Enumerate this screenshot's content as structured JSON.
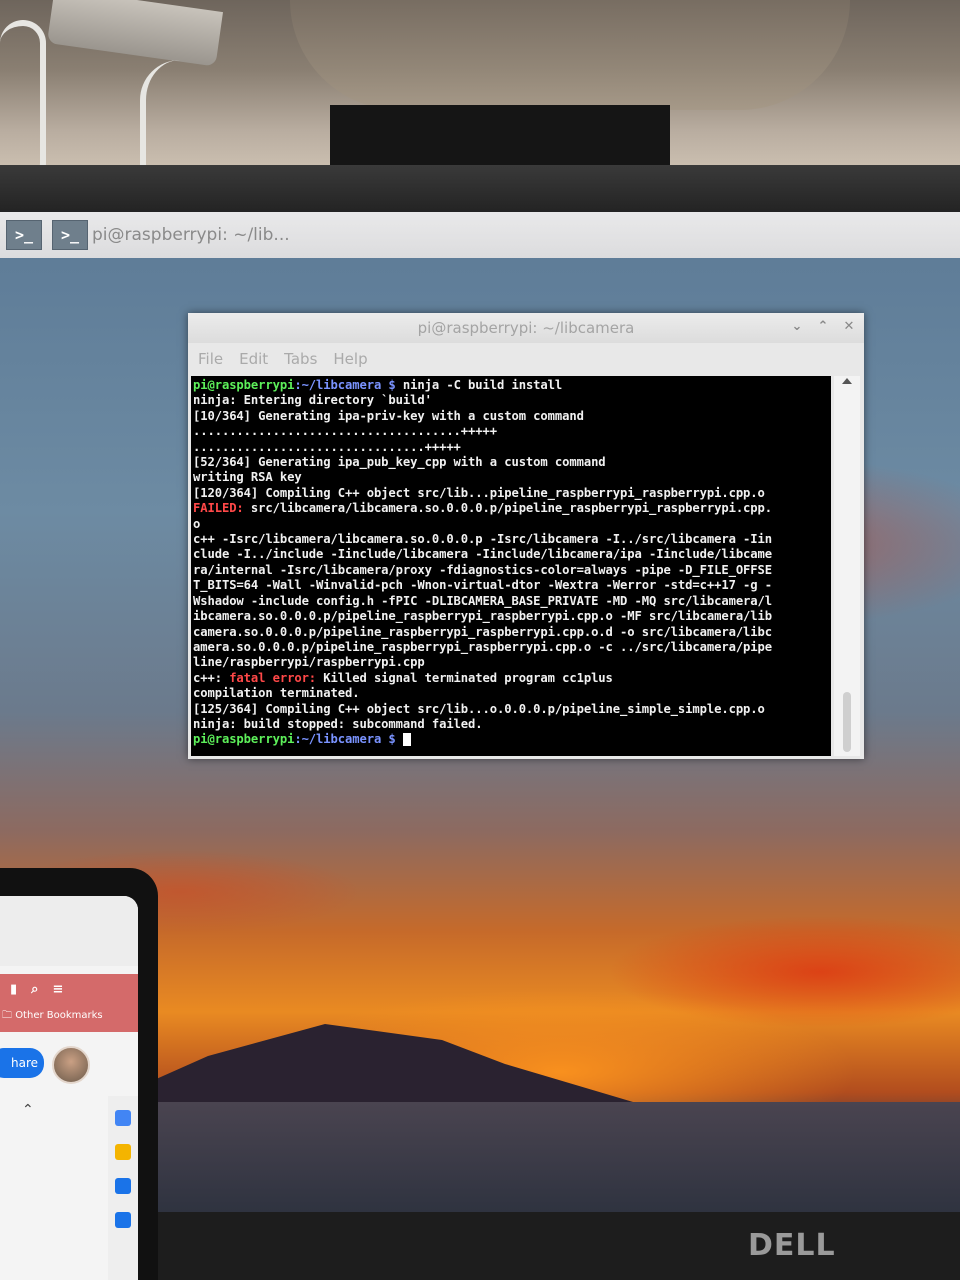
{
  "taskbar": {
    "task_label": "pi@raspberrypi: ~/lib...",
    "terminal_glyph": ">_"
  },
  "window": {
    "title": "pi@raspberrypi: ~/libcamera",
    "controls": {
      "minimize": "⌄",
      "maximize": "⌃",
      "close": "✕"
    },
    "menu": [
      "File",
      "Edit",
      "Tabs",
      "Help"
    ]
  },
  "terminal": {
    "prompt_user": "pi@raspberrypi",
    "prompt_path": ":~/libcamera",
    "prompt_symbol": " $",
    "command": " ninja -C build install",
    "lines": [
      "ninja: Entering directory `build'",
      "[10/364] Generating ipa-priv-key with a custom command",
      ".....................................+++++",
      "................................+++++",
      "[52/364] Generating ipa_pub_key_cpp with a custom command",
      "writing RSA key",
      "[120/364] Compiling C++ object src/lib...pipeline_raspberrypi_raspberrypi.cpp.o"
    ],
    "failed_label": "FAILED:",
    "failed_path": " src/libcamera/libcamera.so.0.0.0.p/pipeline_raspberrypi_raspberrypi.cpp.",
    "failed_cont": "o",
    "compile_lines": [
      "c++ -Isrc/libcamera/libcamera.so.0.0.0.p -Isrc/libcamera -I../src/libcamera -Iin",
      "clude -I../include -Iinclude/libcamera -Iinclude/libcamera/ipa -Iinclude/libcame",
      "ra/internal -Isrc/libcamera/proxy -fdiagnostics-color=always -pipe -D_FILE_OFFSE",
      "T_BITS=64 -Wall -Winvalid-pch -Wnon-virtual-dtor -Wextra -Werror -std=c++17 -g -",
      "Wshadow -include config.h -fPIC -DLIBCAMERA_BASE_PRIVATE -MD -MQ src/libcamera/l",
      "ibcamera.so.0.0.0.p/pipeline_raspberrypi_raspberrypi.cpp.o -MF src/libcamera/lib",
      "camera.so.0.0.0.p/pipeline_raspberrypi_raspberrypi.cpp.o.d -o src/libcamera/libc",
      "amera.so.0.0.0.p/pipeline_raspberrypi_raspberrypi.cpp.o -c ../src/libcamera/pipe",
      "line/raspberrypi/raspberrypi.cpp"
    ],
    "error_prefix": "c++:",
    "error_label": " fatal error:",
    "error_message": " Killed signal terminated program cc1plus",
    "tail_lines": [
      "compilation terminated.",
      "[125/364] Compiling C++ object src/lib...o.0.0.0.p/pipeline_simple_simple.cpp.o",
      "ninja: build stopped: subcommand failed."
    ]
  },
  "phone": {
    "bookmarks": "Other Bookmarks",
    "share_label": "hare"
  },
  "monitor_brand": "DELL"
}
